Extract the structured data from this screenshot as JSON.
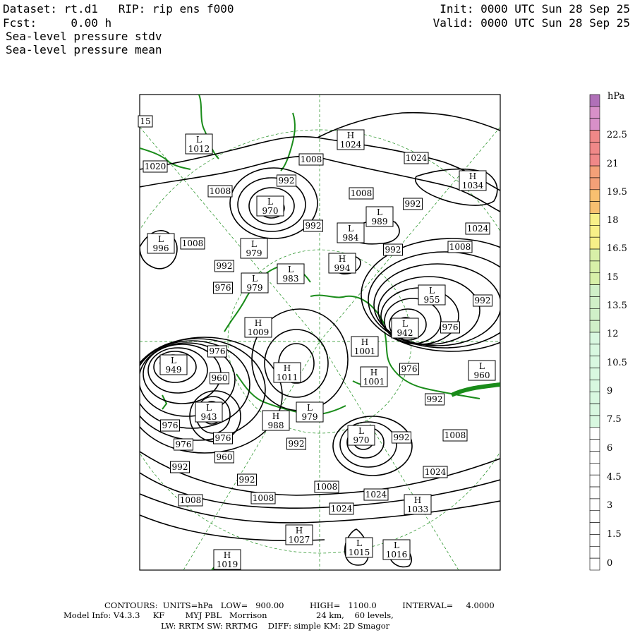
{
  "header": {
    "dataset_line": "Dataset: rt.d1   RIP: rip ens f000",
    "fcst_line": "Fcst:     0.00 h",
    "field1": "Sea-level pressure stdv",
    "field2": "Sea-level pressure mean",
    "init_line": "Init: 0000 UTC Sun 28 Sep 25",
    "valid_line": "Valid: 0000 UTC Sun 28 Sep 25"
  },
  "colorbar": {
    "unit": "hPa",
    "labels": [
      "22.5",
      "21",
      "19.5",
      "18",
      "16.5",
      "15",
      "13.5",
      "12",
      "10.5",
      "9",
      "7.5",
      "6",
      "4.5",
      "3",
      "1.5",
      "0"
    ],
    "colors": {
      "top": "#b070b8",
      "magenta": "#d890c8",
      "pink": "#f08888",
      "salmon": "#f4a078",
      "orange": "#f8c070",
      "yellow": "#f8f088",
      "lightgreen": "#d8f0a8",
      "palegreen": "#d0f0c8",
      "mint": "#d8f8e0",
      "white": "#ffffff"
    }
  },
  "map_labels": [
    {
      "text": "15"
    },
    {
      "text": "L 1012"
    },
    {
      "text": "1020"
    },
    {
      "text": "1008"
    },
    {
      "text": "H 1024"
    },
    {
      "text": "1024"
    },
    {
      "text": "H 1034"
    },
    {
      "text": "992"
    },
    {
      "text": "1008"
    },
    {
      "text": "L 970"
    },
    {
      "text": "1008"
    },
    {
      "text": "L 989"
    },
    {
      "text": "992"
    },
    {
      "text": "L 984"
    },
    {
      "text": "1024"
    },
    {
      "text": "L 996"
    },
    {
      "text": "1008"
    },
    {
      "text": "L 979"
    },
    {
      "text": "992"
    },
    {
      "text": "1008"
    },
    {
      "text": "992"
    },
    {
      "text": "H 994"
    },
    {
      "text": "992"
    },
    {
      "text": "L 983"
    },
    {
      "text": "L 979"
    },
    {
      "text": "976"
    },
    {
      "text": "L 955"
    },
    {
      "text": "992"
    },
    {
      "text": "H 1009"
    },
    {
      "text": "L 942"
    },
    {
      "text": "976"
    },
    {
      "text": "L 949"
    },
    {
      "text": "976"
    },
    {
      "text": "H 1001"
    },
    {
      "text": "H 1011"
    },
    {
      "text": "960"
    },
    {
      "text": "976"
    },
    {
      "text": "H 1001"
    },
    {
      "text": "L 960"
    },
    {
      "text": "L 943"
    },
    {
      "text": "H 988"
    },
    {
      "text": "L 979"
    },
    {
      "text": "992"
    },
    {
      "text": "976"
    },
    {
      "text": "976"
    },
    {
      "text": "960"
    },
    {
      "text": "L 970"
    },
    {
      "text": "992"
    },
    {
      "text": "1008"
    },
    {
      "text": "976"
    },
    {
      "text": "992"
    },
    {
      "text": "992"
    },
    {
      "text": "992"
    },
    {
      "text": "1024"
    },
    {
      "text": "1008"
    },
    {
      "text": "1008"
    },
    {
      "text": "1008"
    },
    {
      "text": "1024"
    },
    {
      "text": "H 1033"
    },
    {
      "text": "1024"
    },
    {
      "text": "H 1027"
    },
    {
      "text": "L 1015"
    },
    {
      "text": "L 1016"
    },
    {
      "text": "H 1019"
    }
  ],
  "footer": {
    "line1": "CONTOURS:  UNITS=hPa   LOW=   900.00          HIGH=   1100.0          INTERVAL=     4.0000",
    "line2": "Model Info: V4.3.3     KF        MYJ PBL   Morrison                   24 km,    60 levels,",
    "line3": "LW: RRTM SW: RRTMG    DIFF: simple KM: 2D Smagor"
  },
  "style": {
    "coast_color": "#1a8c1a",
    "grid_color": "#1a8c1a",
    "contour_color": "#000000"
  }
}
